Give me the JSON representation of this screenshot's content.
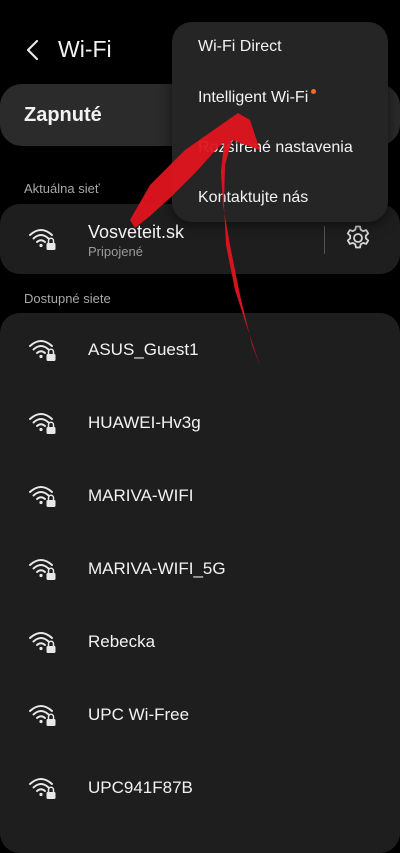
{
  "header": {
    "title": "Wi-Fi",
    "back_icon": "chevron-left-icon"
  },
  "toggle": {
    "label": "Zapnuté"
  },
  "current": {
    "section_label": "Aktuálna sieť",
    "name": "Vosveteit.sk",
    "status": "Pripojené",
    "icon": "wifi-lock-icon",
    "settings_icon": "gear-icon"
  },
  "available": {
    "section_label": "Dostupné siete",
    "networks": [
      {
        "name": "ASUS_Guest1"
      },
      {
        "name": "HUAWEI-Hv3g"
      },
      {
        "name": "MARIVA-WIFI"
      },
      {
        "name": "MARIVA-WIFI_5G"
      },
      {
        "name": "Rebecka"
      },
      {
        "name": "UPC Wi-Free"
      },
      {
        "name": "UPC941F87B"
      }
    ]
  },
  "menu": {
    "items": [
      {
        "label": "Wi-Fi Direct"
      },
      {
        "label": "Intelligent Wi-Fi"
      },
      {
        "label": "Rozšírené nastavenia"
      },
      {
        "label": "Kontaktujte nás"
      }
    ]
  },
  "colors": {
    "notification_dot": "#f26a2e",
    "arrow": "#e0141e",
    "card": "#1e1e1e",
    "menu": "#252525"
  }
}
